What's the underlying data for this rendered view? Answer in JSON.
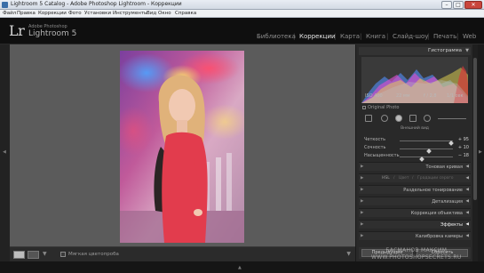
{
  "window": {
    "title": "Lightroom 5 Catalog - Adobe Photoshop Lightroom - Коррекции",
    "controls": {
      "minimize": "–",
      "maximize": "□",
      "close": "✕"
    }
  },
  "menu": [
    "Файл",
    "Правка",
    "Коррекции",
    "Фото",
    "Установки",
    "Инструменты",
    "Вид",
    "Окно",
    "Справка"
  ],
  "identity": {
    "logo": "Lr",
    "subtitle": "Adobe Photoshop",
    "product": "Lightroom 5"
  },
  "modules": [
    {
      "label": "Библиотека",
      "active": false
    },
    {
      "label": "Коррекции",
      "active": true
    },
    {
      "label": "Карта",
      "active": false
    },
    {
      "label": "Книга",
      "active": false
    },
    {
      "label": "Слайд-шоу",
      "active": false
    },
    {
      "label": "Печать",
      "active": false
    },
    {
      "label": "Web",
      "active": false
    }
  ],
  "module_separator": "|",
  "histogram": {
    "title": "Гистограмма",
    "info": [
      "ISO 400",
      "22 мм",
      "f / 2,8",
      "1/1 сек"
    ],
    "original_photo_label": "Original Photo"
  },
  "brush_label": "Внешний вид",
  "adjustments": [
    {
      "label": "Четкость",
      "value": "+ 95",
      "level": 0.97
    },
    {
      "label": "Сочность",
      "value": "+ 10",
      "level": 0.55
    },
    {
      "label": "Насыщенность",
      "value": "− 18",
      "level": 0.41
    }
  ],
  "sections": {
    "tone_curve": "Тоновая кривая",
    "hsl_tabs": [
      "HSL",
      "/",
      "Цвет",
      "/",
      "Градации серого"
    ],
    "split_toning": "Раздельное тонирование",
    "detail": "Детализация",
    "lens_corrections": "Коррекция объектива",
    "effects": "Эффекты",
    "camera_calibration": "Калибровка камеры"
  },
  "bottom_buttons": {
    "previous": "Предыдущие",
    "reset": "Сбросить"
  },
  "toolbar": {
    "soft_proofing": "Мягкая цветопроба"
  },
  "watermark": {
    "line1": "БАСМАНОВ МАКСИМ",
    "line2": "WWW.PHOTOSHOPSECRETS.RU"
  },
  "triangles": {
    "left": "◀",
    "right": "▶",
    "down": "▼",
    "up": "▲"
  }
}
